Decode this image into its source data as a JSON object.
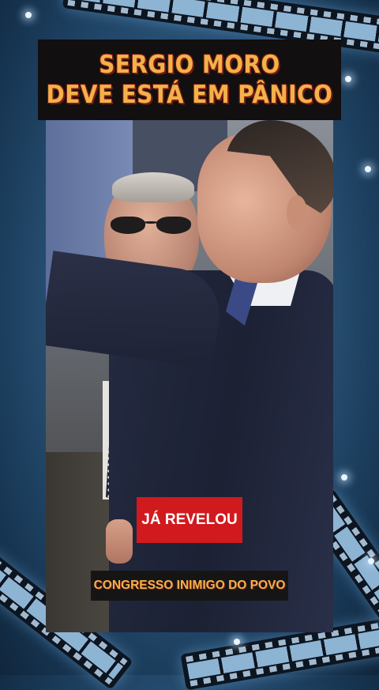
{
  "post": {
    "headline_line1": "SERGIO  MORO",
    "headline_line2": "DEVE  ESTÁ EM  PÂNICO",
    "badge_text": "JÁ REVELOU",
    "caption_text": "CONGRESSO  INIMIGO  DO POVO"
  },
  "colors": {
    "headline_text": "#f2b24a",
    "headline_outline": "#7a1b12",
    "badge_background": "#d11a1e",
    "caption_background": "#161516",
    "page_background": "#2a5378"
  },
  "icons": [
    "film-strip-decoration",
    "sparkle"
  ]
}
